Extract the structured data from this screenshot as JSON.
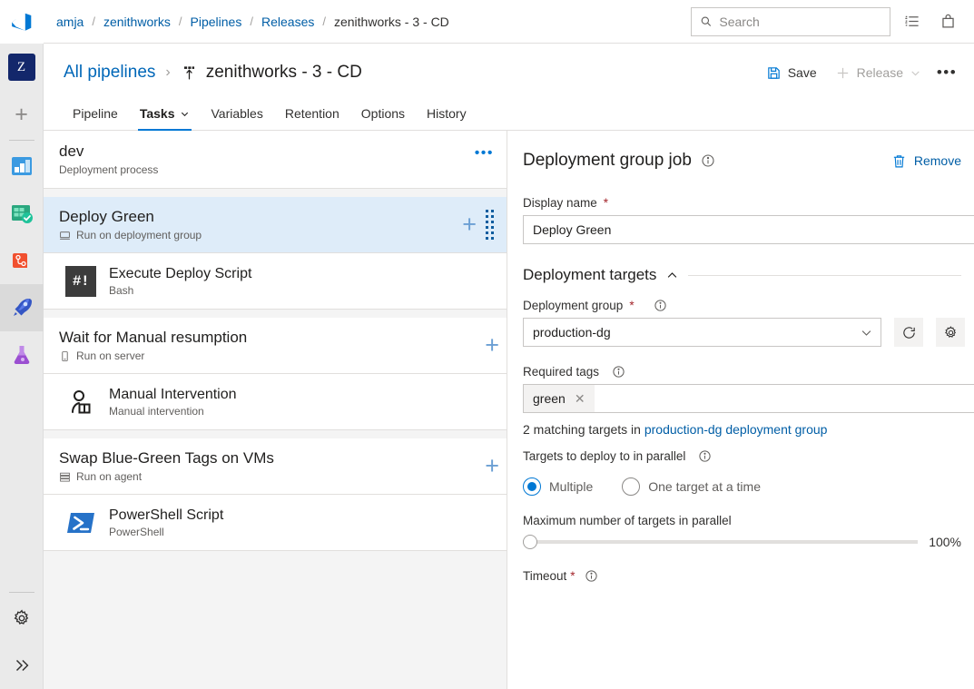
{
  "breadcrumb": {
    "items": [
      "amja",
      "zenithworks",
      "Pipelines",
      "Releases",
      "zenithworks - 3 - CD"
    ],
    "separator": "/"
  },
  "topbar": {
    "search_placeholder": "Search",
    "search_value": "",
    "search_icon": "search-icon",
    "work_items_icon": "work-items-icon",
    "marketplace_icon": "shopping-bag-icon"
  },
  "rail": {
    "project_initial": "Z",
    "add_label": "+",
    "items": [
      {
        "name": "overview",
        "label": "Overview"
      },
      {
        "name": "boards",
        "label": "Boards"
      },
      {
        "name": "repos",
        "label": "Repos"
      },
      {
        "name": "pipelines",
        "label": "Pipelines",
        "active": true
      },
      {
        "name": "test-plans",
        "label": "Test Plans"
      }
    ],
    "settings_label": "Project settings",
    "expand_label": "Expand"
  },
  "pipeline_header": {
    "all_pipelines": "All pipelines",
    "chevron": "›",
    "title": "zenithworks - 3 - CD",
    "save_label": "Save",
    "release_label": "Release",
    "release_caret": "⌄",
    "more_label": "•••"
  },
  "tabs": [
    {
      "label": "Pipeline",
      "active": false,
      "caret": false
    },
    {
      "label": "Tasks",
      "active": true,
      "caret": true
    },
    {
      "label": "Variables",
      "active": false,
      "caret": false
    },
    {
      "label": "Retention",
      "active": false,
      "caret": false
    },
    {
      "label": "Options",
      "active": false,
      "caret": false
    },
    {
      "label": "History",
      "active": false,
      "caret": false
    }
  ],
  "process": {
    "name": "dev",
    "subtitle": "Deployment process",
    "more_label": "•••"
  },
  "task_groups": [
    {
      "phase": {
        "name": "Deploy Green",
        "subtitle": "Run on deployment group",
        "icon": "deployment-group-icon",
        "selected": true,
        "has_drag_handle": true
      },
      "tasks": [
        {
          "name": "Execute Deploy Script",
          "subtitle": "Bash",
          "icon": "bash-icon"
        }
      ]
    },
    {
      "phase": {
        "name": "Wait for Manual resumption",
        "subtitle": "Run on server",
        "icon": "server-icon",
        "selected": false,
        "has_drag_handle": false
      },
      "tasks": [
        {
          "name": "Manual Intervention",
          "subtitle": "Manual intervention",
          "icon": "manual-intervention-icon"
        }
      ]
    },
    {
      "phase": {
        "name": "Swap Blue-Green Tags on VMs",
        "subtitle": "Run on agent",
        "icon": "agent-icon",
        "selected": false,
        "has_drag_handle": false
      },
      "tasks": [
        {
          "name": "PowerShell Script",
          "subtitle": "PowerShell",
          "icon": "powershell-icon"
        }
      ]
    }
  ],
  "details": {
    "title": "Deployment group job",
    "remove_label": "Remove",
    "remove_icon": "trash-icon",
    "display_name": {
      "label": "Display name",
      "required": "*",
      "value": "Deploy Green"
    },
    "section": {
      "title": "Deployment targets",
      "collapse_caret": "⌃"
    },
    "deployment_group": {
      "label": "Deployment group",
      "required": "*",
      "value": "production-dg",
      "refresh_icon": "refresh-icon",
      "manage_icon": "gear-icon"
    },
    "required_tags": {
      "label": "Required tags",
      "tags": [
        "green"
      ],
      "remove_tag_icon": "close-icon"
    },
    "matching": {
      "prefix": "2 matching targets in ",
      "link": "production-dg deployment group"
    },
    "parallel": {
      "label": "Targets to deploy to in parallel",
      "options": [
        {
          "label": "Multiple",
          "selected": true
        },
        {
          "label": "One target at a time",
          "selected": false
        }
      ]
    },
    "max_parallel": {
      "label": "Maximum number of targets in parallel",
      "value_text": "100%",
      "percent": 0
    },
    "timeout": {
      "label": "Timeout",
      "required": "*"
    }
  },
  "colors": {
    "accent": "#0078d4",
    "link": "#005ea6",
    "selection": "#deecf9",
    "required": "#a4262c",
    "panel_bg": "#f4f4f4"
  }
}
